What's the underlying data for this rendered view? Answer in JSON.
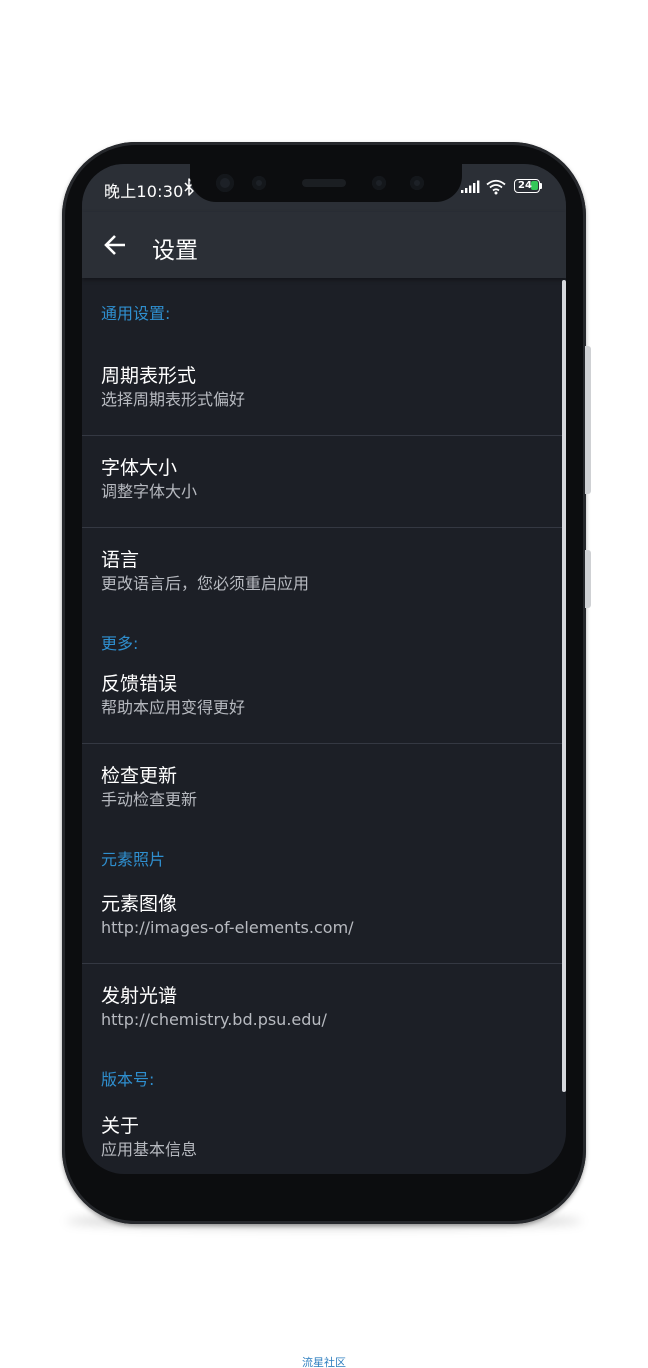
{
  "status_bar": {
    "time": "晚上10:30",
    "battery_level": "24",
    "battery_color": "#35c759"
  },
  "app_bar": {
    "title": "设置",
    "back_icon": "arrow-back-icon"
  },
  "sections": {
    "general": {
      "header": "通用设置:",
      "items": [
        {
          "title": "周期表形式",
          "summary": "选择周期表形式偏好"
        },
        {
          "title": "字体大小",
          "summary": "调整字体大小"
        },
        {
          "title": "语言",
          "summary": "更改语言后，您必须重启应用"
        }
      ]
    },
    "more": {
      "header": "更多:",
      "items": [
        {
          "title": "反馈错误",
          "summary": "帮助本应用变得更好"
        },
        {
          "title": "检查更新",
          "summary": "手动检查更新"
        }
      ]
    },
    "photos": {
      "header": "元素照片",
      "items": [
        {
          "title": "元素图像",
          "summary": "http://images-of-elements.com/"
        },
        {
          "title": "发射光谱",
          "summary": "http://chemistry.bd.psu.edu/"
        }
      ]
    },
    "version": {
      "header": "版本号:",
      "items": [
        {
          "title": "关于",
          "summary": "应用基本信息"
        }
      ]
    }
  },
  "colors": {
    "background": "#1c1f26",
    "toolbar": "#2b2f36",
    "accent": "#2f8fcf"
  },
  "watermark": "流星社区"
}
